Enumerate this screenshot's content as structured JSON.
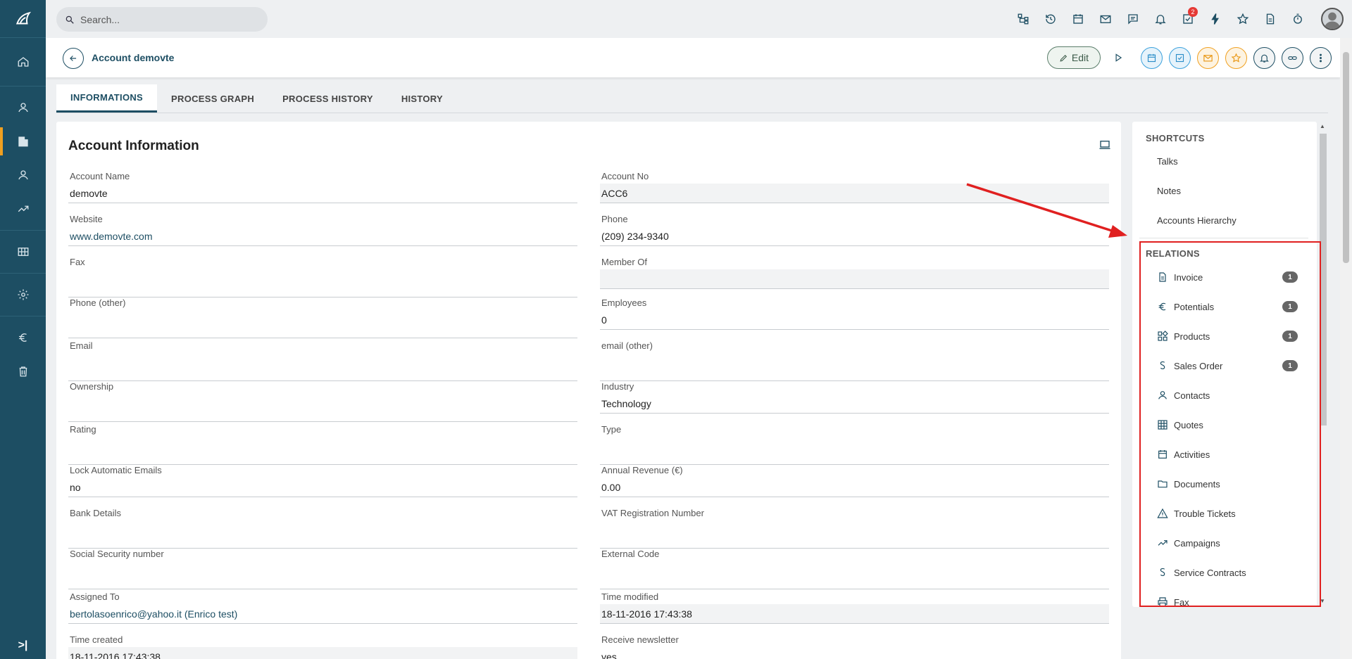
{
  "search": {
    "placeholder": "Search..."
  },
  "topbar": {
    "tasks_badge": "2"
  },
  "header": {
    "title": "Account demovte",
    "edit_label": "Edit"
  },
  "tabs": [
    {
      "label": "INFORMATIONS",
      "active": true
    },
    {
      "label": "PROCESS GRAPH",
      "active": false
    },
    {
      "label": "PROCESS HISTORY",
      "active": false
    },
    {
      "label": "HISTORY",
      "active": false
    }
  ],
  "card": {
    "title": "Account Information",
    "left_fields": [
      {
        "label": "Account Name",
        "value": "demovte"
      },
      {
        "label": "Website",
        "value": "www.demovte.com"
      },
      {
        "label": "Fax",
        "value": ""
      },
      {
        "label": "Phone (other)",
        "value": ""
      },
      {
        "label": "Email",
        "value": ""
      },
      {
        "label": "Ownership",
        "value": ""
      },
      {
        "label": "Rating",
        "value": ""
      },
      {
        "label": "Lock Automatic Emails",
        "value": "no"
      },
      {
        "label": "Bank Details",
        "value": ""
      },
      {
        "label": "Social Security number",
        "value": ""
      },
      {
        "label": "Assigned To",
        "value": "bertolasoenrico@yahoo.it (Enrico test)"
      },
      {
        "label": "Time created",
        "value": "18-11-2016 17:43:38"
      }
    ],
    "right_fields": [
      {
        "label": "Account No",
        "value": "ACC6"
      },
      {
        "label": "Phone",
        "value": "(209) 234-9340"
      },
      {
        "label": "Member Of",
        "value": ""
      },
      {
        "label": "Employees",
        "value": "0"
      },
      {
        "label": "email (other)",
        "value": ""
      },
      {
        "label": "Industry",
        "value": "Technology"
      },
      {
        "label": "Type",
        "value": ""
      },
      {
        "label": "Annual Revenue (€)",
        "value": "0.00"
      },
      {
        "label": "VAT Registration Number",
        "value": ""
      },
      {
        "label": "External Code",
        "value": ""
      },
      {
        "label": "Time modified",
        "value": "18-11-2016 17:43:38"
      },
      {
        "label": "Receive newsletter",
        "value": "yes"
      }
    ]
  },
  "shortcuts": {
    "heading": "SHORTCUTS",
    "items": [
      "Talks",
      "Notes",
      "Accounts Hierarchy"
    ]
  },
  "relations": {
    "heading": "RELATIONS",
    "items": [
      {
        "label": "Invoice",
        "icon": "document-icon",
        "count": "1"
      },
      {
        "label": "Potentials",
        "icon": "euro-icon",
        "count": "1"
      },
      {
        "label": "Products",
        "icon": "products-icon",
        "count": "1"
      },
      {
        "label": "Sales Order",
        "icon": "sales-order-icon",
        "count": "1"
      },
      {
        "label": "Contacts",
        "icon": "person-icon",
        "count": ""
      },
      {
        "label": "Quotes",
        "icon": "calculator-icon",
        "count": ""
      },
      {
        "label": "Activities",
        "icon": "calendar-icon",
        "count": ""
      },
      {
        "label": "Documents",
        "icon": "folder-icon",
        "count": ""
      },
      {
        "label": "Trouble Tickets",
        "icon": "warning-icon",
        "count": ""
      },
      {
        "label": "Campaigns",
        "icon": "trending-icon",
        "count": ""
      },
      {
        "label": "Service Contracts",
        "icon": "service-contract-icon",
        "count": ""
      },
      {
        "label": "Fax",
        "icon": "printer-icon",
        "count": ""
      }
    ]
  },
  "colors": {
    "sidebar": "#1d4e63",
    "accent": "#f0a020",
    "annotation": "#e02020"
  }
}
